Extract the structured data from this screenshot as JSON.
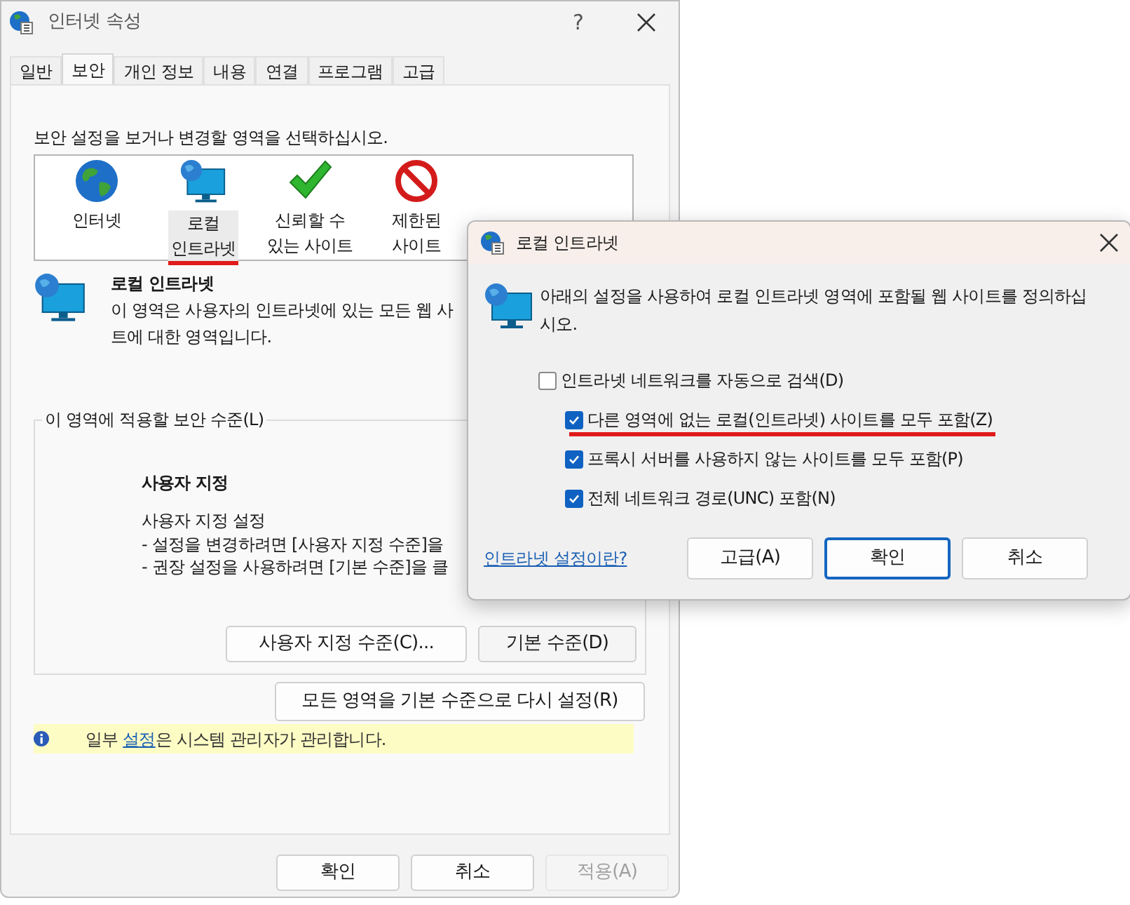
{
  "window": {
    "title": "인터넷 속성",
    "help": "?"
  },
  "tabs": [
    {
      "label": "일반",
      "selected": false
    },
    {
      "label": "보안",
      "selected": true
    },
    {
      "label": "개인 정보",
      "selected": false
    },
    {
      "label": "내용",
      "selected": false
    },
    {
      "label": "연결",
      "selected": false
    },
    {
      "label": "프로그램",
      "selected": false
    },
    {
      "label": "고급",
      "selected": false
    }
  ],
  "zones_prompt": "보안 설정을 보거나 변경할 영역을 선택하십시오.",
  "zones": [
    {
      "kind": "globe",
      "lines": [
        "인터넷"
      ],
      "selected": false,
      "underlined": false
    },
    {
      "kind": "monitor",
      "lines": [
        "로컬",
        "인트라넷"
      ],
      "selected": true,
      "underlined": true
    },
    {
      "kind": "check",
      "lines": [
        "신뢰할 수",
        "있는 사이트"
      ],
      "selected": false,
      "underlined": false
    },
    {
      "kind": "blocked",
      "lines": [
        "제한된",
        "사이트"
      ],
      "selected": false,
      "underlined": false
    }
  ],
  "zone_info": {
    "title": "로컬 인트라넷",
    "lines": [
      "이 영역은 사용자의 인트라넷에 있는 모든 웹 사",
      "트에 대한 영역입니다."
    ]
  },
  "security_level": {
    "legend": "이 영역에 적용할 보안 수준(L)",
    "title": "사용자 지정",
    "lines": [
      "사용자 지정 설정",
      "- 설정을 변경하려면 [사용자 지정 수준]을",
      "- 권장 설정을 사용하려면 [기본 수준]을 클"
    ],
    "buttons": [
      "사용자 지정 수준(C)...",
      "기본 수준(D)"
    ]
  },
  "reset_button": "모든 영역을 기본 수준으로 다시 설정(R)",
  "notice": {
    "before": "일부 ",
    "link": "설정",
    "after": "은 시스템 관리자가 관리합니다."
  },
  "footer_buttons": [
    {
      "label": "확인",
      "disabled": false
    },
    {
      "label": "취소",
      "disabled": false
    },
    {
      "label": "적용(A)",
      "disabled": true
    }
  ],
  "dialog": {
    "title": "로컬 인트라넷",
    "intro": "아래의 설정을 사용하여 로컬 인트라넷 영역에 포함될 웹 사이트를 정의하십시오.",
    "options": [
      {
        "label": "인트라넷 네트워크를 자동으로 검색(D)",
        "checked": false,
        "indented": false,
        "underlined": false
      },
      {
        "label": "다른 영역에 없는 로컬(인트라넷) 사이트를 모두 포함(Z)",
        "checked": true,
        "indented": true,
        "underlined": true
      },
      {
        "label": "프록시 서버를 사용하지 않는 사이트를 모두 포함(P)",
        "checked": true,
        "indented": true,
        "underlined": false
      },
      {
        "label": "전체 네트워크 경로(UNC) 포함(N)",
        "checked": true,
        "indented": true,
        "underlined": false
      }
    ],
    "link": "인트라넷 설정이란?",
    "buttons": [
      {
        "label": "고급(A)",
        "default": false
      },
      {
        "label": "확인",
        "default": true
      },
      {
        "label": "취소",
        "default": false
      }
    ]
  }
}
